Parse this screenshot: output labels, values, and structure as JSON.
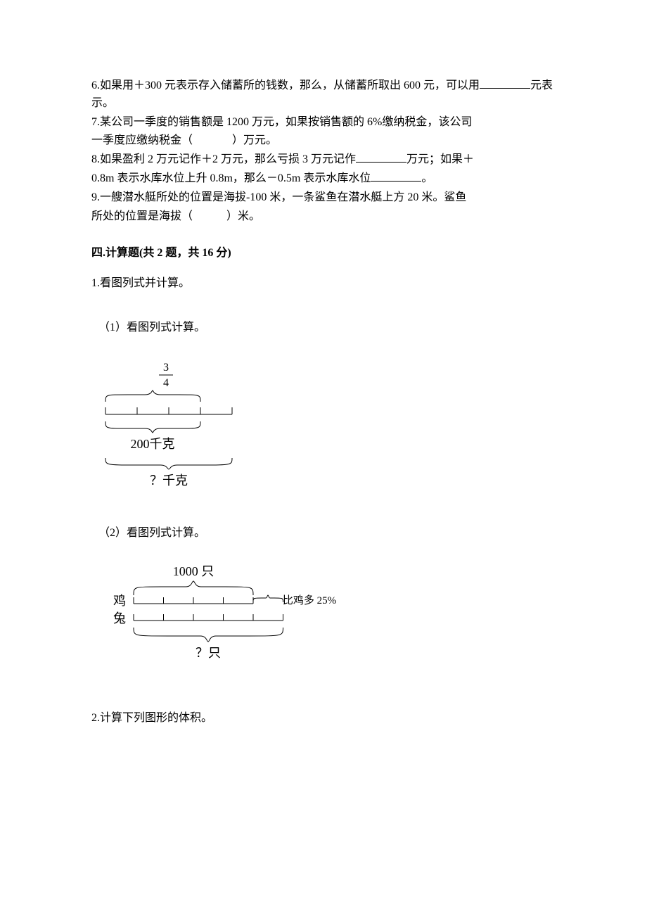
{
  "q6": {
    "pre": "6.如果用＋300 元表示存入储蓄所的钱数，那么，从储蓄所取出 600 元，可以用",
    "post": "元表示。"
  },
  "q7": {
    "line1": "7.某公司一季度的销售额是 1200 万元，如果按销售额的 6%缴纳税金，该公司",
    "line2_pre": "一季度应缴纳税金（",
    "line2_post": "）万元。"
  },
  "q8": {
    "line1_pre": "8.如果盈利 2 万元记作＋2 万元，那么亏损 3 万元记作",
    "line1_post": "万元；如果＋",
    "line2_pre": "0.8m 表示水库水位上升 0.8m，那么－0.5m 表示水库水位",
    "line2_post": "。"
  },
  "q9": {
    "line1": "9.一艘潜水艇所处的位置是海拔-100 米，一条鲨鱼在潜水艇上方 20 米。鲨鱼",
    "line2_pre": "所处的位置是海拔（",
    "line2_post": "）米。"
  },
  "section4_title": "四.计算题(共 2 题，共 16 分)",
  "s4_q1": "1.看图列式并计算。",
  "s4_q1_sub1": "（1）看图列式计算。",
  "s4_q1_sub2": "（2）看图列式计算。",
  "s4_q2": "2.计算下列图形的体积。",
  "diagram1": {
    "frac_num": "3",
    "frac_den": "4",
    "mid_label": "200千克",
    "bottom_label": "？千克"
  },
  "diagram2": {
    "top_label": "1000 只",
    "left_chicken": "鸡",
    "left_rabbit": "兔",
    "right_label": "比鸡多 25%",
    "bottom_label": "？只"
  }
}
